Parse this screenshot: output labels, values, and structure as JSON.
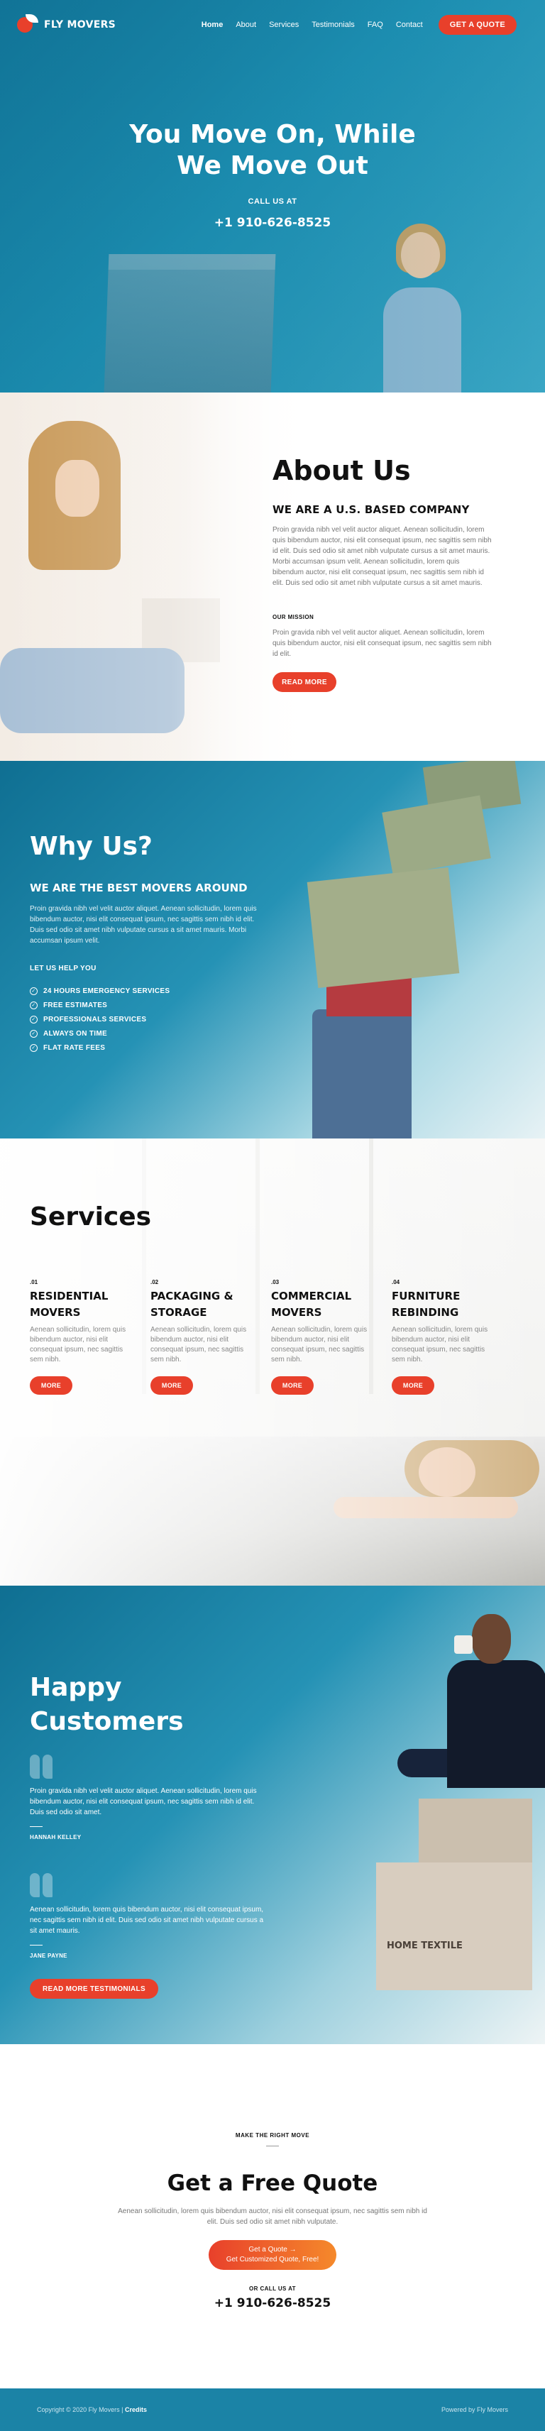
{
  "brand": {
    "name": "FLY MOVERS",
    "accent": "#e8402b",
    "primary": "#1b83a6"
  },
  "nav": {
    "items": [
      {
        "label": "Home",
        "active": true
      },
      {
        "label": "About"
      },
      {
        "label": "Services"
      },
      {
        "label": "Testimonials"
      },
      {
        "label": "FAQ"
      },
      {
        "label": "Contact"
      }
    ],
    "cta": "GET A QUOTE"
  },
  "hero": {
    "title_line1": "You Move On, While",
    "title_line2": "We Move Out",
    "call_label": "CALL US AT",
    "phone": "+1 910-626-8525"
  },
  "about": {
    "title": "About Us",
    "subtitle": "WE ARE A U.S. BASED COMPANY",
    "paragraph": "Proin gravida nibh vel velit auctor aliquet. Aenean sollicitudin, lorem quis bibendum auctor, nisi elit consequat ipsum, nec sagittis sem nibh id elit. Duis sed odio sit amet nibh vulputate cursus a sit amet mauris. Morbi accumsan ipsum velit. Aenean sollicitudin, lorem quis bibendum auctor, nisi elit consequat ipsum, nec sagittis sem nibh id elit. Duis sed odio sit amet nibh vulputate cursus a sit amet mauris.",
    "mission_label": "OUR MISSION",
    "mission_text": "Proin gravida nibh vel velit auctor aliquet. Aenean sollicitudin, lorem quis bibendum auctor, nisi elit consequat ipsum, nec sagittis sem nibh id elit.",
    "button": "READ MORE"
  },
  "why": {
    "title": "Why Us?",
    "subtitle": "WE ARE THE BEST MOVERS AROUND",
    "paragraph": "Proin gravida nibh vel velit auctor aliquet. Aenean sollicitudin, lorem quis bibendum auctor, nisi elit consequat ipsum, nec sagittis sem nibh id elit. Duis sed odio sit amet nibh vulputate cursus a sit amet mauris. Morbi accumsan ipsum velit.",
    "help_label": "LET US HELP YOU",
    "features": [
      "24 HOURS EMERGENCY SERVICES",
      "FREE ESTIMATES",
      "PROFESSIONALS SERVICES",
      "ALWAYS ON TIME",
      "FLAT RATE FEES"
    ]
  },
  "services": {
    "title": "Services",
    "items": [
      {
        "num": ".01",
        "name_l1": "RESIDENTIAL",
        "name_l2": "MOVERS",
        "desc": "Aenean sollicitudin, lorem quis bibendum auctor, nisi elit consequat ipsum, nec sagittis sem nibh.",
        "button": "MORE"
      },
      {
        "num": ".02",
        "name_l1": "PACKAGING &",
        "name_l2": "STORAGE",
        "desc": "Aenean sollicitudin, lorem quis bibendum auctor, nisi elit consequat ipsum, nec sagittis sem nibh.",
        "button": "MORE"
      },
      {
        "num": ".03",
        "name_l1": "COMMERCIAL",
        "name_l2": "MOVERS",
        "desc": "Aenean sollicitudin, lorem quis bibendum auctor, nisi elit consequat ipsum, nec sagittis sem nibh.",
        "button": "MORE"
      },
      {
        "num": ".04",
        "name_l1": "FURNITURE",
        "name_l2": "REBINDING",
        "desc": "Aenean sollicitudin, lorem quis bibendum auctor, nisi elit consequat ipsum, nec sagittis sem nibh.",
        "button": "MORE"
      }
    ]
  },
  "testimonials": {
    "title_line1": "Happy",
    "title_line2": "Customers",
    "items": [
      {
        "quote": "Proin gravida nibh vel velit auctor aliquet. Aenean sollicitudin, lorem quis bibendum auctor, nisi elit consequat ipsum, nec sagittis sem nibh id elit. Duis sed odio sit amet.",
        "name": "HANNAH KELLEY"
      },
      {
        "quote": "Aenean sollicitudin, lorem quis bibendum auctor, nisi elit consequat ipsum, nec sagittis sem nibh id elit. Duis sed odio sit amet nibh vulputate cursus a sit amet mauris.",
        "name": "JANE PAYNE"
      }
    ],
    "button": "READ MORE TESTIMONIALS",
    "box_label": "HOME TEXTILE"
  },
  "quote": {
    "eyebrow": "MAKE THE RIGHT MOVE",
    "title": "Get a Free Quote",
    "paragraph": "Aenean sollicitudin, lorem quis bibendum auctor, nisi elit consequat ipsum, nec sagittis sem nibh id elit. Duis sed odio sit amet nibh vulputate.",
    "button_line1": "Get a Quote →",
    "button_line2": "Get Customized Quote, Free!",
    "call_label": "OR CALL US AT",
    "phone": "+1 910-626-8525"
  },
  "footer": {
    "copyright": "Copyright © 2020 Fly Movers |",
    "credits": "Credits",
    "powered": "Powered by Fly Movers"
  }
}
